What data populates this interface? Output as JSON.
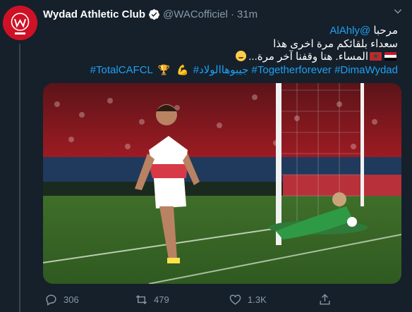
{
  "tweet": {
    "author_name": "Wydad Athletic Club",
    "handle": "@WACofficiel",
    "separator": "·",
    "time": "31m",
    "lines": {
      "mention_prefix": "مرحبا",
      "mention": "@AlAhly",
      "line2": "سعداء بلقائكم مرة اخرى هذا",
      "line3_text": "...المساء. هنا وقفنا آخر مرة",
      "hashtags_line": [
        "#TotalCAFCL",
        "#جيبوهاالولاد",
        "#Togetherforever",
        "#DimaWydad"
      ]
    },
    "icons": {
      "verified": "verified-badge-icon",
      "more": "chevron-down-icon",
      "reply": "reply-icon",
      "retweet": "retweet-icon",
      "like": "heart-icon",
      "share": "share-icon"
    },
    "stats": {
      "replies": "306",
      "retweets": "479",
      "likes": "1.3K"
    },
    "colors": {
      "background": "#15202b",
      "accent": "#1da1f2",
      "muted": "#8899a6",
      "club_red": "#cf1126"
    }
  }
}
